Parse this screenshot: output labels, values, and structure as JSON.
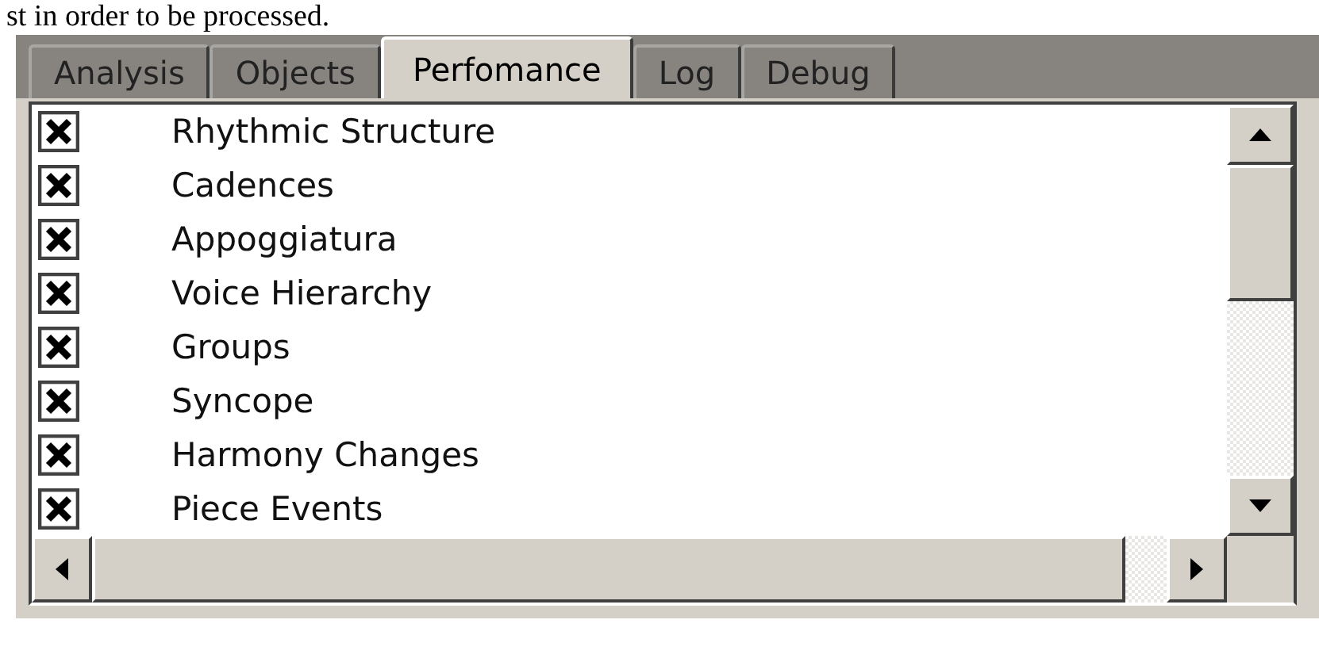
{
  "caption": "st in order to be processed.",
  "tabs": [
    {
      "label": "Analysis",
      "selected": false
    },
    {
      "label": "Objects",
      "selected": false
    },
    {
      "label": "Perfomance",
      "selected": true
    },
    {
      "label": "Log",
      "selected": false
    },
    {
      "label": "Debug",
      "selected": false
    }
  ],
  "options": [
    {
      "label": "Rhythmic Structure",
      "checked": true
    },
    {
      "label": "Cadences",
      "checked": true
    },
    {
      "label": "Appoggiatura",
      "checked": true
    },
    {
      "label": "Voice Hierarchy",
      "checked": true
    },
    {
      "label": "Groups",
      "checked": true
    },
    {
      "label": "Syncope",
      "checked": true
    },
    {
      "label": "Harmony Changes",
      "checked": true
    },
    {
      "label": "Piece Events",
      "checked": true
    }
  ]
}
